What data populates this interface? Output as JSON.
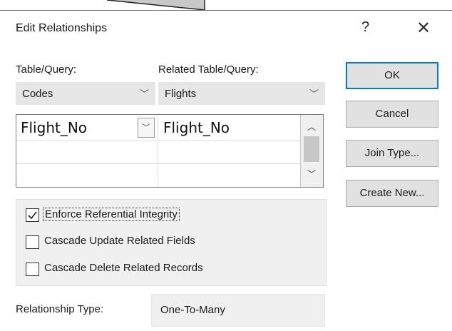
{
  "dialog": {
    "title": "Edit Relationships",
    "help_glyph": "?",
    "close_glyph": "✕"
  },
  "table_query": {
    "label": "Table/Query:",
    "value": "Codes"
  },
  "related_table_query": {
    "label": "Related Table/Query:",
    "value": "Flights"
  },
  "fields_grid": {
    "rows": [
      {
        "left": "Flight_No",
        "right": "Flight_No"
      },
      {
        "left": "",
        "right": ""
      },
      {
        "left": "",
        "right": ""
      }
    ]
  },
  "options": {
    "enforce": {
      "label": "Enforce Referential Integrity",
      "checked": true
    },
    "cascade_update": {
      "label": "Cascade Update Related Fields",
      "checked": false
    },
    "cascade_delete": {
      "label": "Cascade Delete Related Records",
      "checked": false
    }
  },
  "relationship_type": {
    "label": "Relationship Type:",
    "value": "One-To-Many"
  },
  "buttons": {
    "ok": "OK",
    "cancel": "Cancel",
    "join_type": "Join Type...",
    "create_new": "Create New..."
  },
  "icons": {
    "chevron_down": "chevron-down-icon",
    "chevron_up": "chevron-up-icon",
    "checkmark": "check-icon",
    "close": "close-icon"
  },
  "colors": {
    "default_button_border": "#0078d7",
    "combo_bg": "#e6e6e6"
  }
}
